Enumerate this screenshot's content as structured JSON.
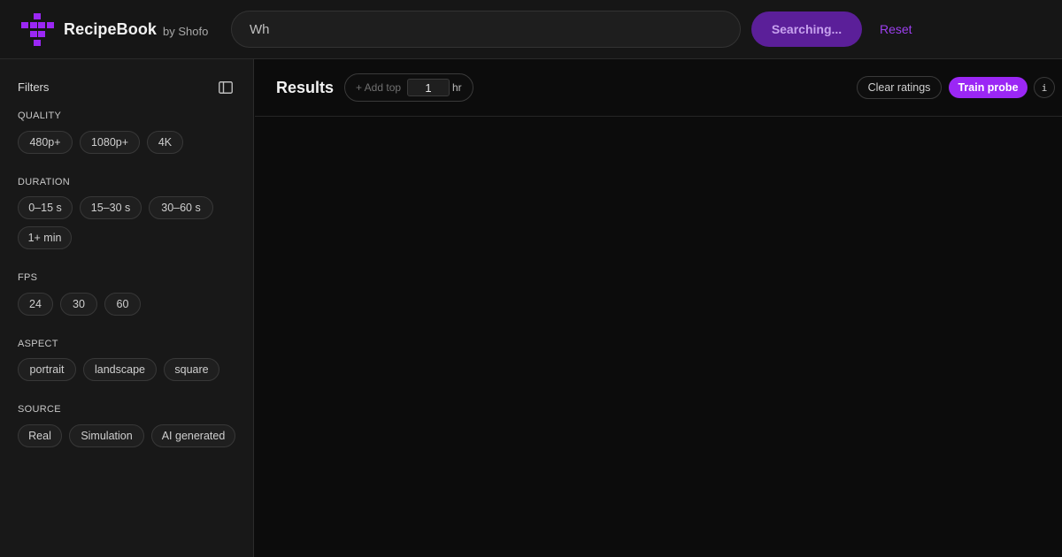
{
  "header": {
    "brand": "RecipeBook",
    "by_label": "by Shofo",
    "search_value": "Wh",
    "search_button_label": "Searching...",
    "reset_label": "Reset",
    "accent_color": "#9d3ff0"
  },
  "sidebar": {
    "title": "Filters",
    "sections": [
      {
        "label": "QUALITY",
        "options": [
          "480p+",
          "1080p+",
          "4K"
        ]
      },
      {
        "label": "DURATION",
        "options": [
          "0–15 s",
          "15–30 s",
          "30–60 s",
          "1+ min"
        ]
      },
      {
        "label": "FPS",
        "options": [
          "24",
          "30",
          "60"
        ]
      },
      {
        "label": "ASPECT",
        "options": [
          "portrait",
          "landscape",
          "square"
        ]
      },
      {
        "label": "SOURCE",
        "options": [
          "Real",
          "Simulation",
          "AI generated"
        ]
      }
    ]
  },
  "results": {
    "title": "Results",
    "add_top_label": "+ Add top",
    "add_top_value": "1",
    "add_top_unit": "hr",
    "clear_ratings_label": "Clear ratings",
    "train_probe_label": "Train probe",
    "info_label": "i"
  }
}
